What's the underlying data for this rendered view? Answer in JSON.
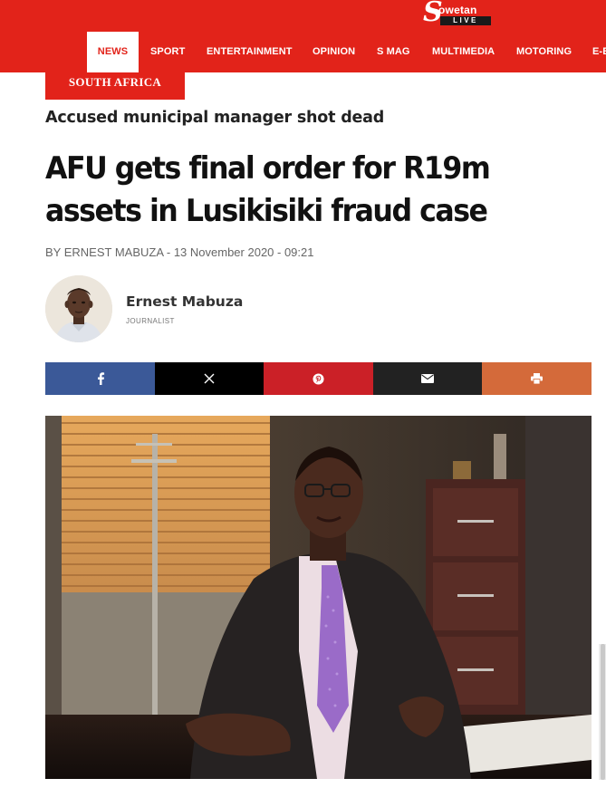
{
  "header": {
    "logo_text": "Sowetan",
    "logo_sub": "LIVE",
    "brand_color": "#e2231a",
    "nav": [
      {
        "label": "NEWS",
        "active": true
      },
      {
        "label": "SPORT",
        "active": false
      },
      {
        "label": "ENTERTAINMENT",
        "active": false
      },
      {
        "label": "OPINION",
        "active": false
      },
      {
        "label": "S MAG",
        "active": false
      },
      {
        "label": "MULTIMEDIA",
        "active": false
      },
      {
        "label": "MOTORING",
        "active": false
      },
      {
        "label": "E-E",
        "active": false
      }
    ]
  },
  "article": {
    "section": "SOUTH AFRICA",
    "kicker": "Accused municipal manager shot dead",
    "headline": "AFU gets final order for R19m assets in Lusikisiki fraud case",
    "byline": "BY ERNEST MABUZA - 13 November 2020 - 09:21",
    "author": {
      "name": "Ernest Mabuza",
      "role": "JOURNALIST"
    }
  },
  "share": [
    {
      "name": "facebook",
      "icon": "facebook-icon",
      "color": "#3b5998"
    },
    {
      "name": "x",
      "icon": "x-icon",
      "color": "#000000"
    },
    {
      "name": "pinterest",
      "icon": "pinterest-icon",
      "color": "#cb2027"
    },
    {
      "name": "email",
      "icon": "envelope-icon",
      "color": "#222222"
    },
    {
      "name": "print",
      "icon": "printer-icon",
      "color": "#d46a3a"
    }
  ]
}
